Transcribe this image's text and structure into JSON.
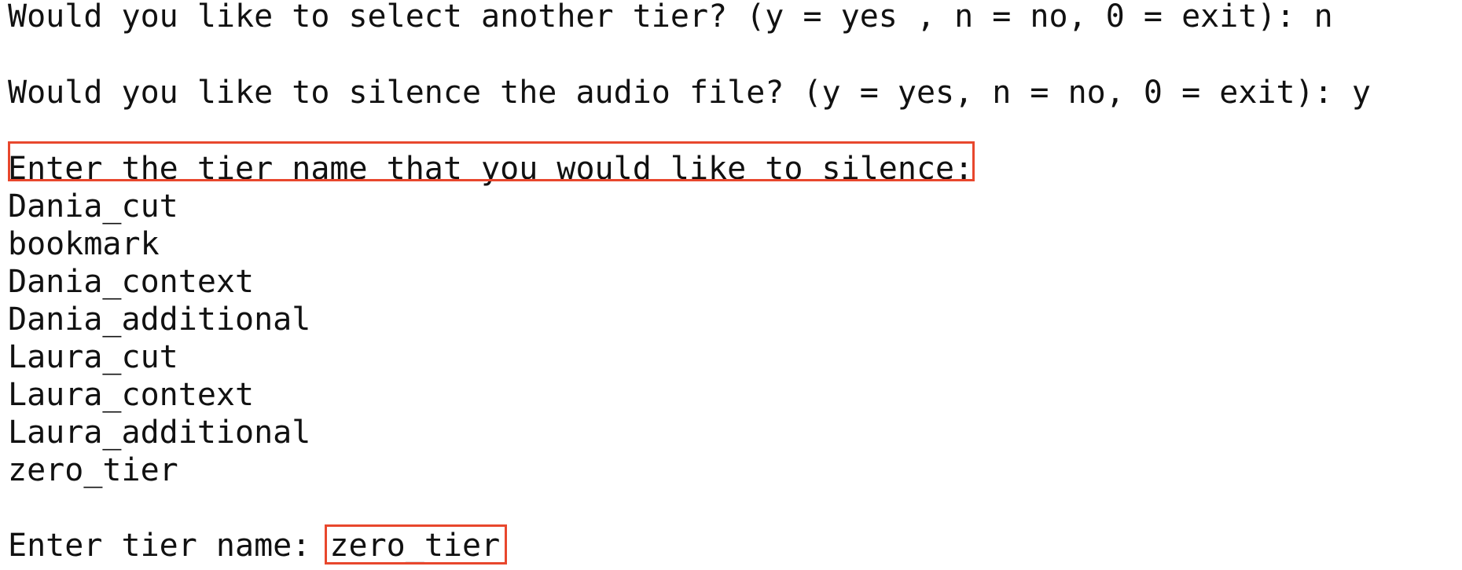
{
  "terminal": {
    "lines": [
      "Would you like to select another tier? (y = yes , n = no, 0 = exit): n",
      "Would you like to silence the audio file? (y = yes, n = no, 0 = exit): y",
      "Enter the tier name that you would like to silence:",
      "Dania_cut",
      "bookmark",
      "Dania_context",
      "Dania_additional",
      "Laura_cut",
      "Laura_context",
      "Laura_additional",
      "zero_tier"
    ],
    "prompt_label": "Enter tier name: ",
    "prompt_value": "zero_tier",
    "highlight_color": "#e8472d"
  }
}
